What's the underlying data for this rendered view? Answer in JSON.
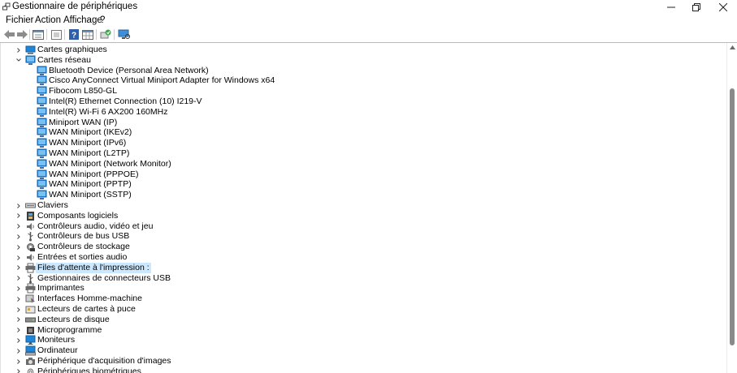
{
  "window": {
    "title": "Gestionnaire de périphériques"
  },
  "menu": {
    "items": [
      "Fichier",
      "Action",
      "Affichage",
      "?"
    ]
  },
  "toolbar": {
    "buttons": [
      "back-icon",
      "forward-icon",
      "properties-icon",
      "grid-icon",
      "help-icon",
      "details-icon",
      "update-driver-icon",
      "monitor-scan-icon"
    ]
  },
  "tree": {
    "rows": [
      {
        "label": "Cartes graphiques",
        "level": 0,
        "expanded": false,
        "icon": "display-adapter-icon"
      },
      {
        "label": "Cartes réseau",
        "level": 0,
        "expanded": true,
        "icon": "network-adapter-icon"
      },
      {
        "label": "Bluetooth Device (Personal Area Network)",
        "level": 1,
        "icon": "network-device-icon"
      },
      {
        "label": "Cisco AnyConnect Virtual Miniport Adapter for Windows x64",
        "level": 1,
        "icon": "network-device-icon"
      },
      {
        "label": "Fibocom L850-GL",
        "level": 1,
        "icon": "network-device-icon"
      },
      {
        "label": "Intel(R) Ethernet Connection (10) I219-V",
        "level": 1,
        "icon": "network-device-icon"
      },
      {
        "label": "Intel(R) Wi-Fi 6 AX200 160MHz",
        "level": 1,
        "icon": "network-device-icon"
      },
      {
        "label": "Miniport WAN (IP)",
        "level": 1,
        "icon": "network-device-icon"
      },
      {
        "label": "WAN Miniport (IKEv2)",
        "level": 1,
        "icon": "network-device-icon"
      },
      {
        "label": "WAN Miniport (IPv6)",
        "level": 1,
        "icon": "network-device-icon"
      },
      {
        "label": "WAN Miniport (L2TP)",
        "level": 1,
        "icon": "network-device-icon"
      },
      {
        "label": "WAN Miniport (Network Monitor)",
        "level": 1,
        "icon": "network-device-icon"
      },
      {
        "label": "WAN Miniport (PPPOE)",
        "level": 1,
        "icon": "network-device-icon"
      },
      {
        "label": "WAN Miniport (PPTP)",
        "level": 1,
        "icon": "network-device-icon"
      },
      {
        "label": "WAN Miniport (SSTP)",
        "level": 1,
        "icon": "network-device-icon"
      },
      {
        "label": "Claviers",
        "level": 0,
        "expanded": false,
        "icon": "keyboard-icon"
      },
      {
        "label": "Composants logiciels",
        "level": 0,
        "expanded": false,
        "icon": "software-component-icon"
      },
      {
        "label": "Contrôleurs audio, vidéo et jeu",
        "level": 0,
        "expanded": false,
        "icon": "speaker-icon"
      },
      {
        "label": "Contrôleurs de bus USB",
        "level": 0,
        "expanded": false,
        "icon": "usb-icon"
      },
      {
        "label": "Contrôleurs de stockage",
        "level": 0,
        "expanded": false,
        "icon": "storage-controller-icon"
      },
      {
        "label": "Entrées et sorties audio",
        "level": 0,
        "expanded": false,
        "icon": "speaker-icon"
      },
      {
        "label": "Files d'attente à l'impression :",
        "level": 0,
        "expanded": false,
        "selected": true,
        "icon": "printer-icon"
      },
      {
        "label": "Gestionnaires de connecteurs USB",
        "level": 0,
        "expanded": false,
        "icon": "usb-icon"
      },
      {
        "label": "Imprimantes",
        "level": 0,
        "expanded": false,
        "icon": "printer-icon"
      },
      {
        "label": "Interfaces Homme-machine",
        "level": 0,
        "expanded": false,
        "icon": "hid-icon"
      },
      {
        "label": "Lecteurs de cartes à puce",
        "level": 0,
        "expanded": false,
        "icon": "smart-card-icon"
      },
      {
        "label": "Lecteurs de disque",
        "level": 0,
        "expanded": false,
        "icon": "disk-drive-icon"
      },
      {
        "label": "Microprogramme",
        "level": 0,
        "expanded": false,
        "icon": "firmware-icon"
      },
      {
        "label": "Moniteurs",
        "level": 0,
        "expanded": false,
        "icon": "monitor-icon"
      },
      {
        "label": "Ordinateur",
        "level": 0,
        "expanded": false,
        "icon": "computer-icon"
      },
      {
        "label": "Périphérique d'acquisition d'images",
        "level": 0,
        "expanded": false,
        "icon": "camera-icon"
      },
      {
        "label": "Périphériques biométriques",
        "level": 0,
        "expanded": false,
        "icon": "biometric-icon"
      }
    ]
  },
  "colors": {
    "selection": "#cce8ff",
    "accent": "#1e86d8",
    "scroll_thumb": "#8a8a8a"
  }
}
